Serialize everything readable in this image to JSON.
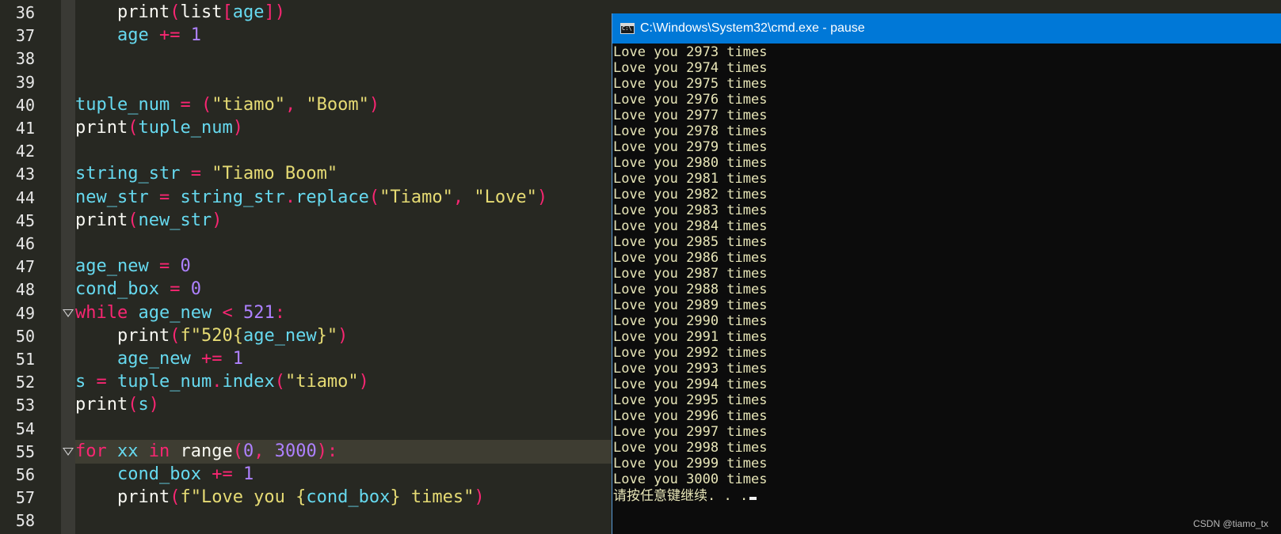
{
  "editor": {
    "line_numbers": [
      "36",
      "37",
      "38",
      "39",
      "40",
      "41",
      "42",
      "43",
      "44",
      "45",
      "46",
      "47",
      "48",
      "49",
      "50",
      "51",
      "52",
      "53",
      "54",
      "55",
      "56",
      "57",
      "58"
    ],
    "lines": [
      [
        [
          "    ",
          "plain"
        ],
        [
          "print",
          "bi"
        ],
        [
          "(",
          "op"
        ],
        [
          "list",
          "bi"
        ],
        [
          "[",
          "op"
        ],
        [
          "age",
          "var"
        ],
        [
          "])",
          "op"
        ]
      ],
      [
        [
          "    ",
          "plain"
        ],
        [
          "age",
          "var"
        ],
        [
          " += ",
          "op"
        ],
        [
          "1",
          "num"
        ]
      ],
      [],
      [],
      [
        [
          "tuple_num",
          "var"
        ],
        [
          " = ",
          "op"
        ],
        [
          "(",
          "op"
        ],
        [
          "\"tiamo\"",
          "str"
        ],
        [
          ", ",
          "op"
        ],
        [
          "\"Boom\"",
          "str"
        ],
        [
          ")",
          "op"
        ]
      ],
      [
        [
          "print",
          "bi"
        ],
        [
          "(",
          "op"
        ],
        [
          "tuple_num",
          "var"
        ],
        [
          ")",
          "op"
        ]
      ],
      [],
      [
        [
          "string_str",
          "var"
        ],
        [
          " = ",
          "op"
        ],
        [
          "\"Tiamo Boom\"",
          "str"
        ]
      ],
      [
        [
          "new_str",
          "var"
        ],
        [
          " = ",
          "op"
        ],
        [
          "string_str",
          "var"
        ],
        [
          ".",
          "op"
        ],
        [
          "replace",
          "var"
        ],
        [
          "(",
          "op"
        ],
        [
          "\"Tiamo\"",
          "str"
        ],
        [
          ", ",
          "op"
        ],
        [
          "\"Love\"",
          "str"
        ],
        [
          ")",
          "op"
        ]
      ],
      [
        [
          "print",
          "bi"
        ],
        [
          "(",
          "op"
        ],
        [
          "new_str",
          "var"
        ],
        [
          ")",
          "op"
        ]
      ],
      [],
      [
        [
          "age_new",
          "var"
        ],
        [
          " = ",
          "op"
        ],
        [
          "0",
          "num"
        ]
      ],
      [
        [
          "cond_box",
          "var"
        ],
        [
          " = ",
          "op"
        ],
        [
          "0",
          "num"
        ]
      ],
      [
        [
          "while",
          "kw"
        ],
        [
          " ",
          "plain"
        ],
        [
          "age_new",
          "var"
        ],
        [
          " < ",
          "op"
        ],
        [
          "521",
          "num"
        ],
        [
          ":",
          "op"
        ]
      ],
      [
        [
          "    ",
          "plain"
        ],
        [
          "print",
          "bi"
        ],
        [
          "(",
          "op"
        ],
        [
          "f\"520{",
          "str"
        ],
        [
          "age_new",
          "var"
        ],
        [
          "}\"",
          "str"
        ],
        [
          ")",
          "op"
        ]
      ],
      [
        [
          "    ",
          "plain"
        ],
        [
          "age_new",
          "var"
        ],
        [
          " += ",
          "op"
        ],
        [
          "1",
          "num"
        ]
      ],
      [
        [
          "s",
          "var"
        ],
        [
          " = ",
          "op"
        ],
        [
          "tuple_num",
          "var"
        ],
        [
          ".",
          "op"
        ],
        [
          "index",
          "var"
        ],
        [
          "(",
          "op"
        ],
        [
          "\"tiamo\"",
          "str"
        ],
        [
          ")",
          "op"
        ]
      ],
      [
        [
          "print",
          "bi"
        ],
        [
          "(",
          "op"
        ],
        [
          "s",
          "var"
        ],
        [
          ")",
          "op"
        ]
      ],
      [],
      [
        [
          "for",
          "kw"
        ],
        [
          " ",
          "plain"
        ],
        [
          "xx",
          "var"
        ],
        [
          " in ",
          "kw"
        ],
        [
          "range",
          "bi"
        ],
        [
          "(",
          "op"
        ],
        [
          "0",
          "num"
        ],
        [
          ", ",
          "op"
        ],
        [
          "3000",
          "num"
        ],
        [
          "):",
          "op"
        ]
      ],
      [
        [
          "    ",
          "plain"
        ],
        [
          "cond_box",
          "var"
        ],
        [
          " += ",
          "op"
        ],
        [
          "1",
          "num"
        ]
      ],
      [
        [
          "    ",
          "plain"
        ],
        [
          "print",
          "bi"
        ],
        [
          "(",
          "op"
        ],
        [
          "f\"Love you {",
          "str"
        ],
        [
          "cond_box",
          "var"
        ],
        [
          "} times\"",
          "str"
        ],
        [
          ")",
          "op"
        ]
      ],
      []
    ],
    "current_line": "55",
    "fold_markers": [
      "49",
      "55"
    ],
    "colors": {
      "background": "#272822",
      "keyword": "#f92672",
      "string": "#e6db74",
      "number": "#ae81ff",
      "identifier": "#66d9ef"
    }
  },
  "cmd": {
    "title": "C:\\Windows\\System32\\cmd.exe - pause",
    "icon": "console-window-icon",
    "output": [
      "Love you 2973 times",
      "Love you 2974 times",
      "Love you 2975 times",
      "Love you 2976 times",
      "Love you 2977 times",
      "Love you 2978 times",
      "Love you 2979 times",
      "Love you 2980 times",
      "Love you 2981 times",
      "Love you 2982 times",
      "Love you 2983 times",
      "Love you 2984 times",
      "Love you 2985 times",
      "Love you 2986 times",
      "Love you 2987 times",
      "Love you 2988 times",
      "Love you 2989 times",
      "Love you 2990 times",
      "Love you 2991 times",
      "Love you 2992 times",
      "Love you 2993 times",
      "Love you 2994 times",
      "Love you 2995 times",
      "Love you 2996 times",
      "Love you 2997 times",
      "Love you 2998 times",
      "Love you 2999 times",
      "Love you 3000 times"
    ],
    "prompt": "请按任意键继续. . .",
    "colors": {
      "titlebar": "#0078d7",
      "background": "#0c0c0c",
      "text": "#e8e6b8"
    }
  },
  "watermark": "CSDN @tiamo_tx"
}
